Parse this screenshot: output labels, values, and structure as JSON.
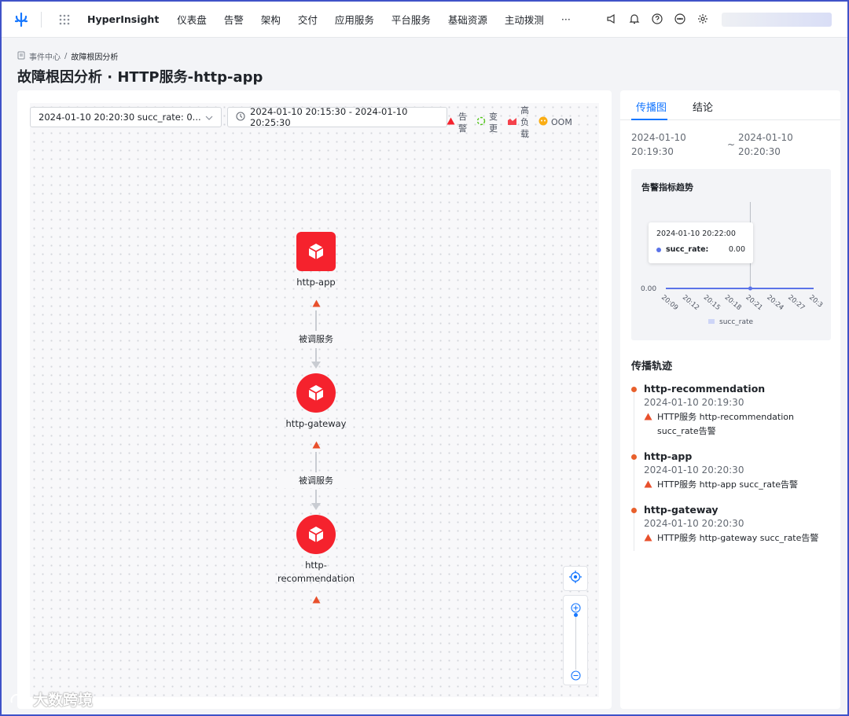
{
  "topbar": {
    "brand": "HyperInsight",
    "nav": [
      "仪表盘",
      "告警",
      "架构",
      "交付",
      "应用服务",
      "平台服务",
      "基础资源",
      "主动拨测",
      "···"
    ],
    "icons": [
      "megaphone-icon",
      "bell-icon",
      "help-icon",
      "chat-icon",
      "gear-icon"
    ]
  },
  "breadcrumb": {
    "root": "事件中心",
    "separator": "/",
    "current": "故障根因分析"
  },
  "page": {
    "title": "故障根因分析 · HTTP服务-http-app"
  },
  "filters": {
    "alert_select": "2024-01-10 20:20:30 succ_rate: 0...",
    "time_range": "2024-01-10 20:15:30 - 2024-01-10 20:25:30"
  },
  "legend": [
    {
      "label": "告警",
      "icon": "warning-icon",
      "color": "#f5222d"
    },
    {
      "label": "变更",
      "icon": "refresh-icon",
      "color": "#52c41a"
    },
    {
      "label": "高负载",
      "icon": "chart-icon",
      "color": "#f5222d"
    },
    {
      "label": "OOM",
      "icon": "oom-icon",
      "color": "#faad14"
    }
  ],
  "graph": {
    "nodes": [
      {
        "label": "http-app",
        "shape": "square"
      },
      {
        "label": "http-gateway",
        "shape": "circle"
      },
      {
        "label": "http-\nrecommendation",
        "shape": "circle"
      }
    ],
    "edges": [
      {
        "label": "被调服务"
      },
      {
        "label": "被调服务"
      }
    ]
  },
  "sidepanel": {
    "tabs": [
      "传播图",
      "结论"
    ],
    "active_tab": "传播图",
    "range_start": "2024-01-10 20:19:30",
    "range_end": "2024-01-10 20:20:30",
    "range_sep": "~",
    "chart_title": "告警指标趋势",
    "track_title": "传播轨迹",
    "tooltip": {
      "time": "2024-01-10 20:22:00",
      "series": "succ_rate:",
      "value": "0.00"
    },
    "timeline": [
      {
        "name": "http-recommendation",
        "time": "2024-01-10 20:19:30",
        "alert": "HTTP服务 http-recommendation succ_rate告警"
      },
      {
        "name": "http-app",
        "time": "2024-01-10 20:20:30",
        "alert": "HTTP服务 http-app succ_rate告警"
      },
      {
        "name": "http-gateway",
        "time": "2024-01-10 20:20:30",
        "alert": "HTTP服务 http-gateway succ_rate告警"
      }
    ]
  },
  "chart_data": {
    "type": "line",
    "title": "告警指标趋势",
    "x": [
      "20:09",
      "20:12",
      "20:15",
      "20:18",
      "20:21",
      "20:24",
      "20:27",
      "20:3"
    ],
    "series": [
      {
        "name": "succ_rate",
        "values": [
          0,
          0,
          0,
          0,
          0,
          0,
          0,
          0
        ]
      }
    ],
    "yticks": [
      "0.00"
    ],
    "legend": "bottom",
    "colors": {
      "series": "#5b73e8",
      "legend": "#cdd5f7"
    }
  },
  "watermark": "大数跨境"
}
